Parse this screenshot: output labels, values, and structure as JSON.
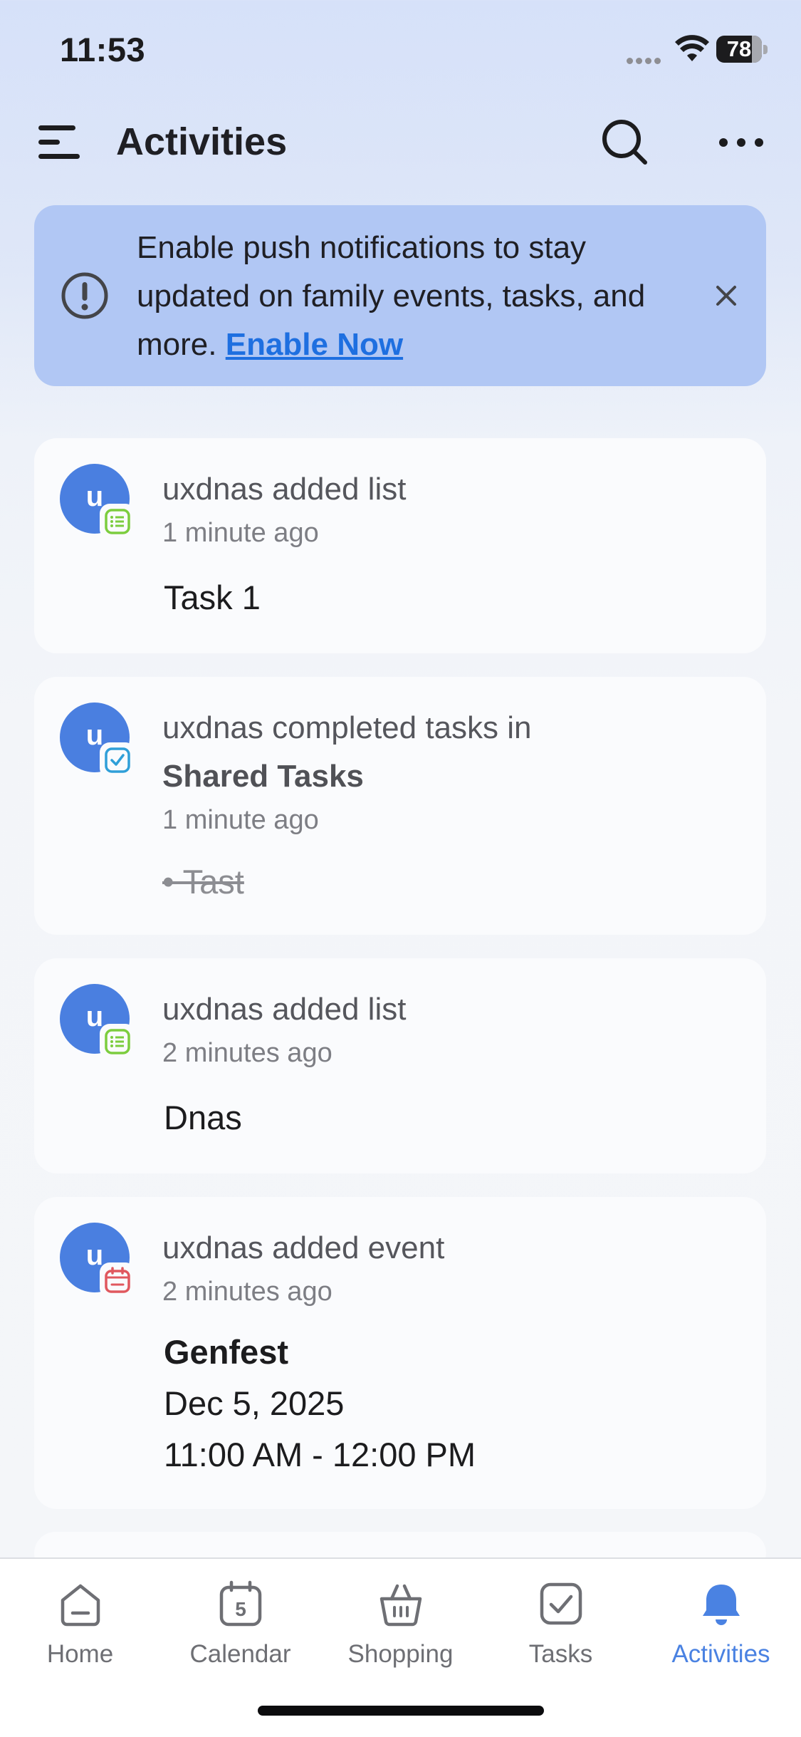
{
  "status_bar": {
    "time": "11:53",
    "battery": "78",
    "battery_level_percent": 78
  },
  "header": {
    "title": "Activities"
  },
  "banner": {
    "text": "Enable push notifications to stay updated on family events, tasks, and more.",
    "link": "Enable Now"
  },
  "activities": [
    {
      "avatar": "u",
      "title": "uxdnas added list",
      "time": "1 minute ago",
      "content": "Task 1",
      "icon": "list-icon"
    },
    {
      "avatar": "u",
      "title_prefix": "uxdnas completed tasks in",
      "title_bold": "Shared Tasks",
      "time": "1 minute ago",
      "content": "• Tast",
      "icon": "checkbox-icon"
    },
    {
      "avatar": "u",
      "title": "uxdnas added list",
      "time": "2 minutes ago",
      "content": "Dnas",
      "icon": "list-icon"
    },
    {
      "avatar": "u",
      "title": "uxdnas added event",
      "time": "2 minutes ago",
      "event_name": "Genfest",
      "event_date": "Dec 5, 2025",
      "event_time": "11:00 AM - 12:00 PM",
      "icon": "calendar-icon"
    }
  ],
  "tabs": [
    {
      "label": "Home",
      "icon": "home-icon"
    },
    {
      "label": "Calendar",
      "icon": "calendar-icon",
      "badge": "5"
    },
    {
      "label": "Shopping",
      "icon": "basket-icon"
    },
    {
      "label": "Tasks",
      "icon": "checkbox-icon"
    },
    {
      "label": "Activities",
      "icon": "bell-icon",
      "active": true
    }
  ],
  "colors": {
    "accent": "#4a82e2",
    "avatar": "#4a7fe0",
    "banner": "#b1c7f4",
    "list_badge": "#7ccd3e",
    "task_badge": "#2f9fd8",
    "event_badge": "#e0585e"
  }
}
